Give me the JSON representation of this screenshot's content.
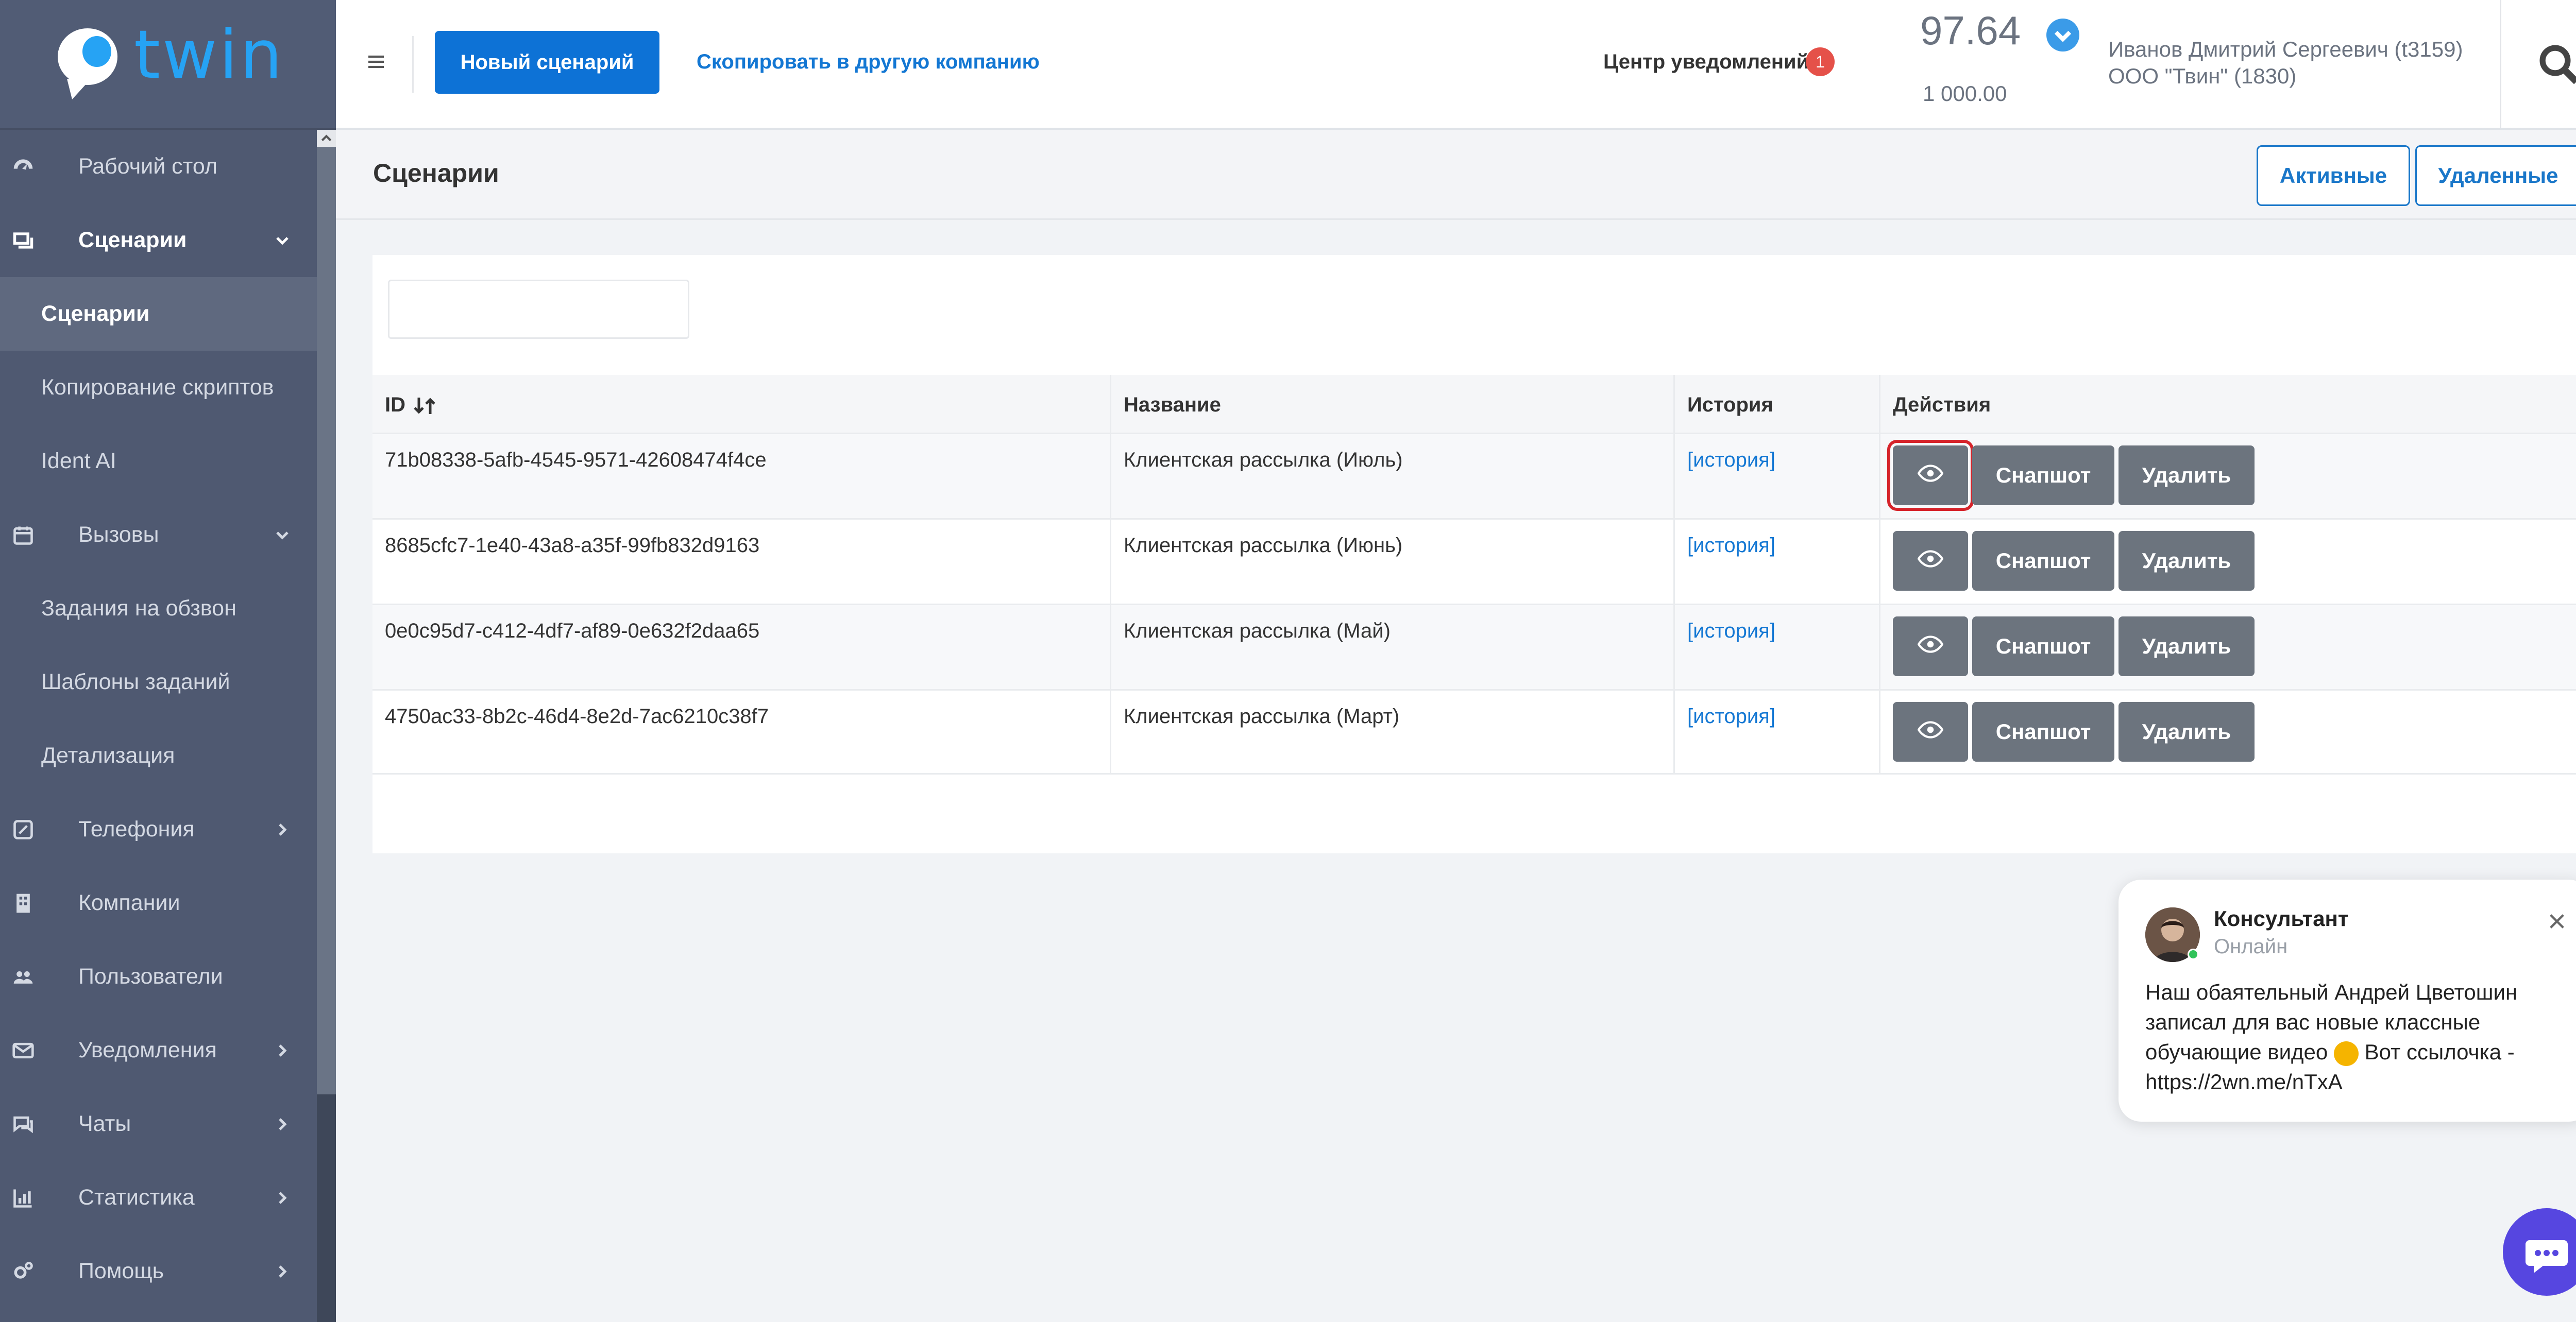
{
  "app": {
    "logo_text": "twin",
    "brand_color": "#26a3f4",
    "sidebar_color": "#4f5971"
  },
  "sidebar": {
    "items": [
      {
        "label": "Рабочий стол",
        "icon": "dashboard-icon"
      },
      {
        "label": "Сценарии",
        "icon": "scenarios-icon",
        "expanded": true
      },
      {
        "label": "Сценарии",
        "sub": true,
        "active": true
      },
      {
        "label": "Копирование скриптов",
        "sub": true
      },
      {
        "label": "Ident AI",
        "sub": true
      },
      {
        "label": "Вызовы",
        "icon": "calendar-icon",
        "expanded": true
      },
      {
        "label": "Задания на обзвон",
        "sub": true
      },
      {
        "label": "Шаблоны заданий",
        "sub": true
      },
      {
        "label": "Детализация",
        "sub": true
      },
      {
        "label": "Телефония",
        "icon": "phone-icon"
      },
      {
        "label": "Компании",
        "icon": "building-icon"
      },
      {
        "label": "Пользователи",
        "icon": "users-icon"
      },
      {
        "label": "Уведомления",
        "icon": "envelope-icon"
      },
      {
        "label": "Чаты",
        "icon": "chat-icon"
      },
      {
        "label": "Статистика",
        "icon": "chart-icon"
      },
      {
        "label": "Помощь",
        "icon": "help-gears-icon"
      }
    ]
  },
  "header": {
    "new_scenario_label": "Новый сценарий",
    "copy_link_label": "Скопировать в другую компанию",
    "notifications_label": "Центр уведомлений",
    "notifications_count": "1",
    "balance": "97.64",
    "limit": "1 000.00",
    "user_name": "Иванов Дмитрий Сергеевич (t3159)",
    "company_name": "ООО \"Твин\" (1830)"
  },
  "page": {
    "title": "Сценарии",
    "tabs": {
      "active_label": "Активные",
      "deleted_label": "Удаленные"
    },
    "filter_value": ""
  },
  "table": {
    "columns": {
      "id": "ID",
      "name": "Название",
      "history": "История",
      "actions": "Действия"
    },
    "rows": [
      {
        "id": "71b08338-5afb-4545-9571-42608474f4ce",
        "name": "Клиентская рассылка (Июль)",
        "history": "[история]",
        "snapshot": "Снапшот",
        "delete": "Удалить"
      },
      {
        "id": "8685cfc7-1e40-43a8-a35f-99fb832d9163",
        "name": "Клиентская рассылка (Июнь)",
        "history": "[история]",
        "snapshot": "Снапшот",
        "delete": "Удалить"
      },
      {
        "id": "0e0c95d7-c412-4df7-af89-0e632f2daa65",
        "name": "Клиентская рассылка (Май)",
        "history": "[история]",
        "snapshot": "Снапшот",
        "delete": "Удалить"
      },
      {
        "id": "4750ac33-8b2c-46d4-8e2d-7ac6210c38f7",
        "name": "Клиентская рассылка (Март)",
        "history": "[история]",
        "snapshot": "Снапшот",
        "delete": "Удалить"
      }
    ]
  },
  "chat": {
    "title": "Консультант",
    "status": "Онлайн",
    "message_part1": "Наш обаятельный Андрей Цветошин записал для вас новые классные обучающие видео",
    "message_part2": "Вот ссылочка - https://2wn.me/nTxA"
  }
}
